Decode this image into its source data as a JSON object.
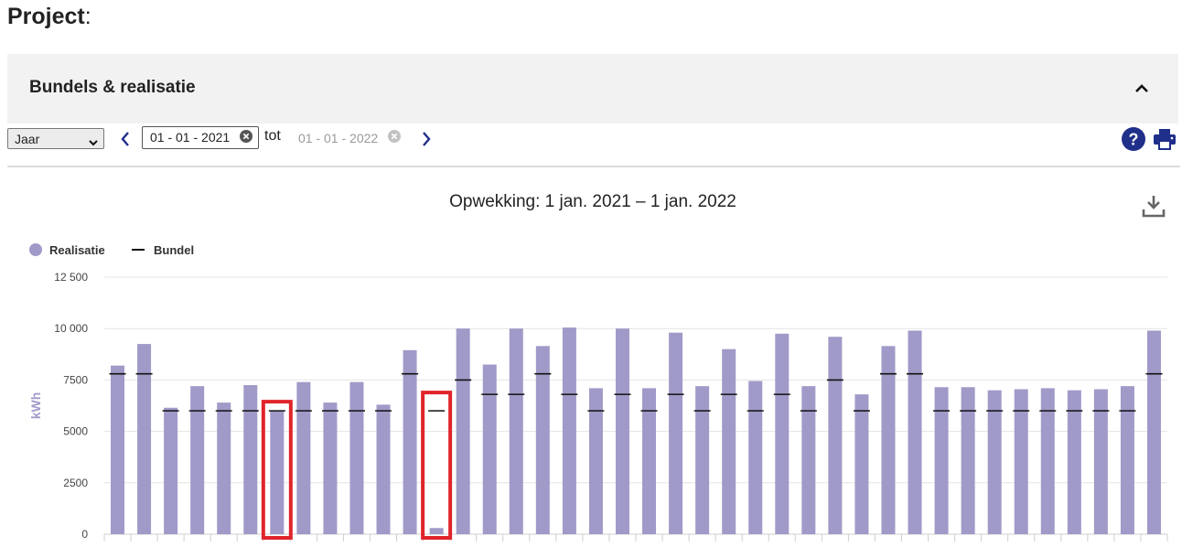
{
  "page": {
    "title": "Project",
    "title_suffix": ":"
  },
  "panel": {
    "title": "Bundels & realisatie",
    "collapse_icon": "chevron-up-icon"
  },
  "toolbar": {
    "period_select": {
      "value": "Jaar"
    },
    "date_from": "01 - 01 - 2021",
    "tot_label": "tot",
    "date_to": "01 - 01 - 2022",
    "icons": [
      "chevron-left-icon",
      "chevron-right-icon",
      "clear-icon",
      "help-icon",
      "print-icon"
    ],
    "accent_color": "#1f2f8a"
  },
  "chart_data": {
    "type": "bar",
    "title": "Opwekking: 1 jan. 2021 – 1 jan. 2022",
    "ylabel": "kWh",
    "ylim": [
      0,
      12500
    ],
    "yticks": [
      0,
      2500,
      5000,
      7500,
      10000,
      12500
    ],
    "ytick_labels": [
      "0",
      "2500",
      "5000",
      "7500",
      "10 000",
      "12 500"
    ],
    "grid": true,
    "legend": {
      "position": "top-left",
      "entries": [
        "Realisatie",
        "Bundel"
      ]
    },
    "colors": {
      "realisatie": "#a09ac8",
      "bundel": "#111111",
      "highlight": "#e0242b"
    },
    "series": [
      {
        "name": "Realisatie",
        "kind": "bar",
        "values": [
          8200,
          9250,
          6150,
          7200,
          6400,
          7250,
          6000,
          7400,
          6400,
          7400,
          6300,
          8950,
          300,
          10000,
          8250,
          10000,
          9150,
          10050,
          7100,
          10000,
          7100,
          9800,
          7200,
          9000,
          7450,
          9750,
          7200,
          9600,
          6800,
          9150,
          9900,
          7150,
          7150,
          7000,
          7050,
          7100,
          7000,
          7050,
          7200,
          9900
        ]
      },
      {
        "name": "Bundel",
        "kind": "marker",
        "values": [
          7800,
          7800,
          6000,
          6000,
          6000,
          6000,
          6000,
          6000,
          6000,
          6000,
          6000,
          7800,
          6000,
          7500,
          6800,
          6800,
          7800,
          6800,
          6000,
          6800,
          6000,
          6800,
          6000,
          6800,
          6000,
          6800,
          6000,
          7500,
          6000,
          7800,
          7800,
          6000,
          6000,
          6000,
          6000,
          6000,
          6000,
          6000,
          6000,
          7800
        ]
      }
    ],
    "highlighted_bars": [
      6,
      12
    ]
  }
}
